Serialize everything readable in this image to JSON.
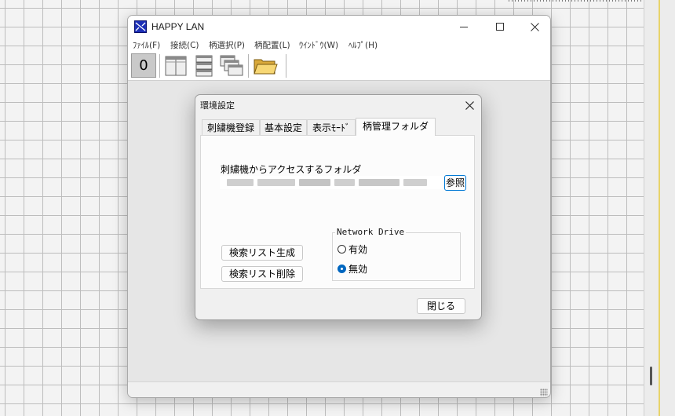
{
  "app": {
    "title": "HAPPY LAN",
    "menu": [
      "ﾌｧｲﾙ(F)",
      "接続(C)",
      "柄選択(P)",
      "柄配置(L)",
      "ｳｲﾝﾄﾞｳ(W)",
      "ﾍﾙﾌﾟ(H)"
    ],
    "toolbar": {
      "counter": "0",
      "icons": [
        "split-view-icon",
        "stack-view-icon",
        "cascade-windows-icon",
        "open-folder-icon"
      ]
    }
  },
  "dialog": {
    "title": "環境設定",
    "tabs": [
      "刺繍機登録",
      "基本設定",
      "表示ﾓｰﾄﾞ",
      "柄管理フォルダ"
    ],
    "active_tab": 3,
    "folder_label": "刺繍機からアクセスするフォルダ",
    "folder_path": "",
    "browse_label": "参照",
    "buttons": {
      "generate": "検索リスト生成",
      "delete": "検索リスト削除",
      "close": "閉じる"
    },
    "network_drive": {
      "legend": "Network Drive",
      "options": [
        {
          "label": "有効",
          "checked": false
        },
        {
          "label": "無効",
          "checked": true
        }
      ]
    }
  },
  "colors": {
    "accent": "#0067c0",
    "app_icon": "#1c2fb7",
    "focus_border": "#0078d4"
  }
}
